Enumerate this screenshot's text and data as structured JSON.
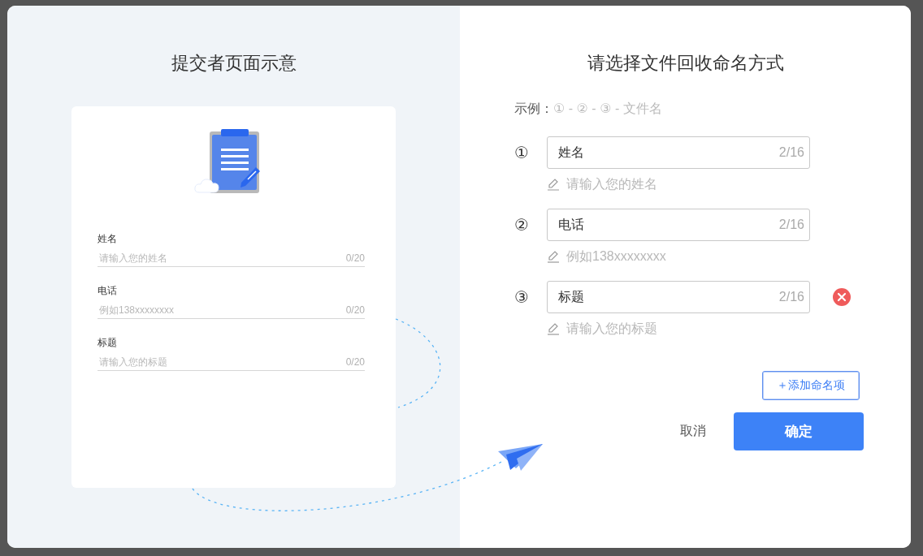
{
  "preview": {
    "title": "提交者页面示意",
    "fields": [
      {
        "label": "姓名",
        "placeholder": "请输入您的姓名",
        "counter": "0/20"
      },
      {
        "label": "电话",
        "placeholder": "例如138xxxxxxxx",
        "counter": "0/20"
      },
      {
        "label": "标题",
        "placeholder": "请输入您的标题",
        "counter": "0/20"
      }
    ]
  },
  "naming": {
    "title": "请选择文件回收命名方式",
    "example": {
      "label": "示例：",
      "pattern": "① - ② - ③ - 文件名"
    },
    "items": [
      {
        "number": "①",
        "value": "姓名",
        "counter": "2/16",
        "hint": "请输入您的姓名",
        "removable": false
      },
      {
        "number": "②",
        "value": "电话",
        "counter": "2/16",
        "hint": "例如138xxxxxxxx",
        "removable": false
      },
      {
        "number": "③",
        "value": "标题",
        "counter": "2/16",
        "hint": "请输入您的标题",
        "removable": true
      }
    ],
    "add_button": "＋添加命名项",
    "cancel": "取消",
    "confirm": "确定"
  }
}
